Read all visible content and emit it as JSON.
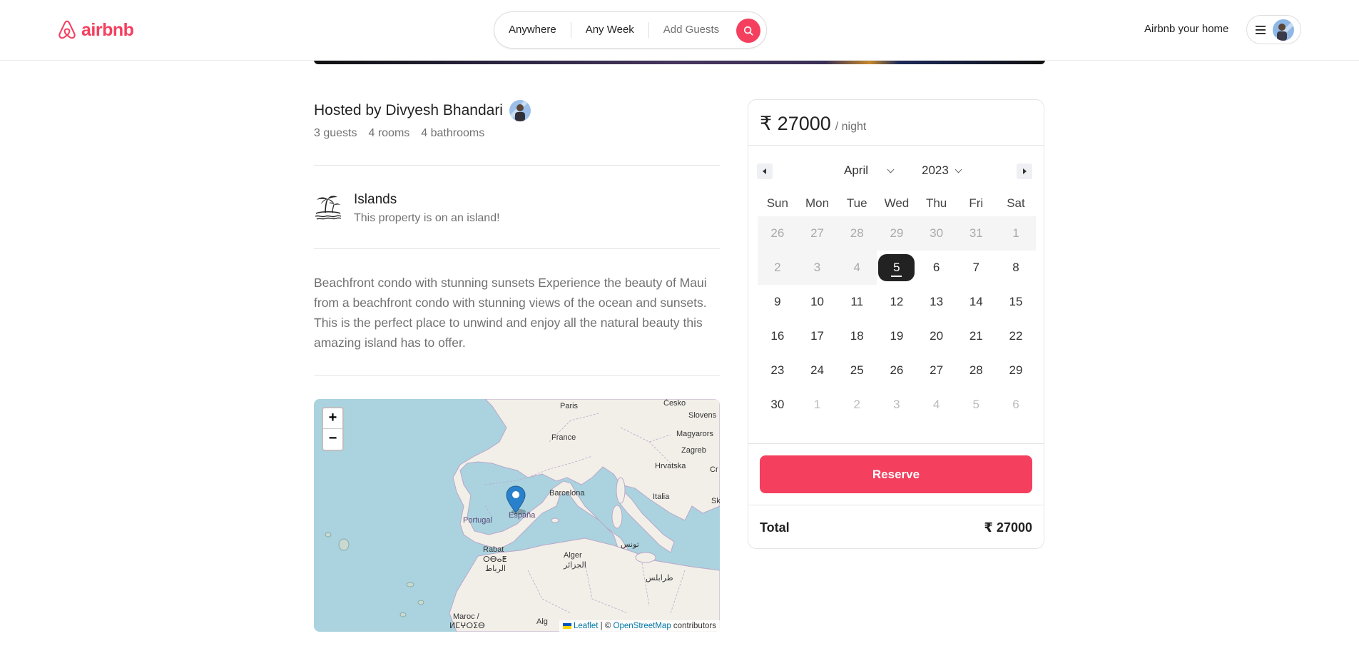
{
  "header": {
    "logo_text": "airbnb",
    "search": {
      "where": "Anywhere",
      "when": "Any Week",
      "guests": "Add Guests"
    },
    "host_link": "Airbnb your home"
  },
  "listing": {
    "host_title": "Hosted by Divyesh Bhandari",
    "stats": [
      "3 guests",
      "4 rooms",
      "4 bathrooms"
    ],
    "category": {
      "name": "Islands",
      "description": "This property is on an island!",
      "icon": "island-palm-icon"
    },
    "description": "Beachfront condo with stunning sunsets Experience the beauty of Maui from a beachfront condo with stunning views of the ocean and sunsets. This is the perfect place to unwind and enjoy all the natural beauty this amazing island has to offer."
  },
  "map": {
    "zoom_in": "+",
    "zoom_out": "−",
    "labels": [
      "Paris",
      "Česko",
      "Slovens",
      "Magyarors",
      "Zagreb",
      "France",
      "Hrvatska",
      "Italia",
      "Barcelona",
      "Portugal",
      "España",
      "Rabat",
      "ⵔⴱⴰⵟ",
      "الرباط",
      "Alger",
      "الجزائر",
      "تونس",
      "طرابلس",
      "Maroc /",
      "ⵍⵎⵖⵔⵉⴱ",
      "Alg",
      "Cr",
      "Sk"
    ],
    "attribution": {
      "leaflet": "Leaflet",
      "sep": " | © ",
      "osm": "OpenStreetMap",
      "tail": " contributors"
    }
  },
  "booking": {
    "price": "₹ 27000",
    "per_night": "/ night",
    "month": "April",
    "year": "2023",
    "weekdays": [
      "Sun",
      "Mon",
      "Tue",
      "Wed",
      "Thu",
      "Fri",
      "Sat"
    ],
    "weeks": [
      [
        "26",
        "27",
        "28",
        "29",
        "30",
        "31",
        "1"
      ],
      [
        "2",
        "3",
        "4",
        "5",
        "6",
        "7",
        "8"
      ],
      [
        "9",
        "10",
        "11",
        "12",
        "13",
        "14",
        "15"
      ],
      [
        "16",
        "17",
        "18",
        "19",
        "20",
        "21",
        "22"
      ],
      [
        "23",
        "24",
        "25",
        "26",
        "27",
        "28",
        "29"
      ],
      [
        "30",
        "1",
        "2",
        "3",
        "4",
        "5",
        "6"
      ]
    ],
    "selected_day": "5",
    "reserve_label": "Reserve",
    "total_label": "Total",
    "total_value": "₹ 27000"
  },
  "colors": {
    "brand": "#f43f5e",
    "muted_text": "#717171"
  }
}
